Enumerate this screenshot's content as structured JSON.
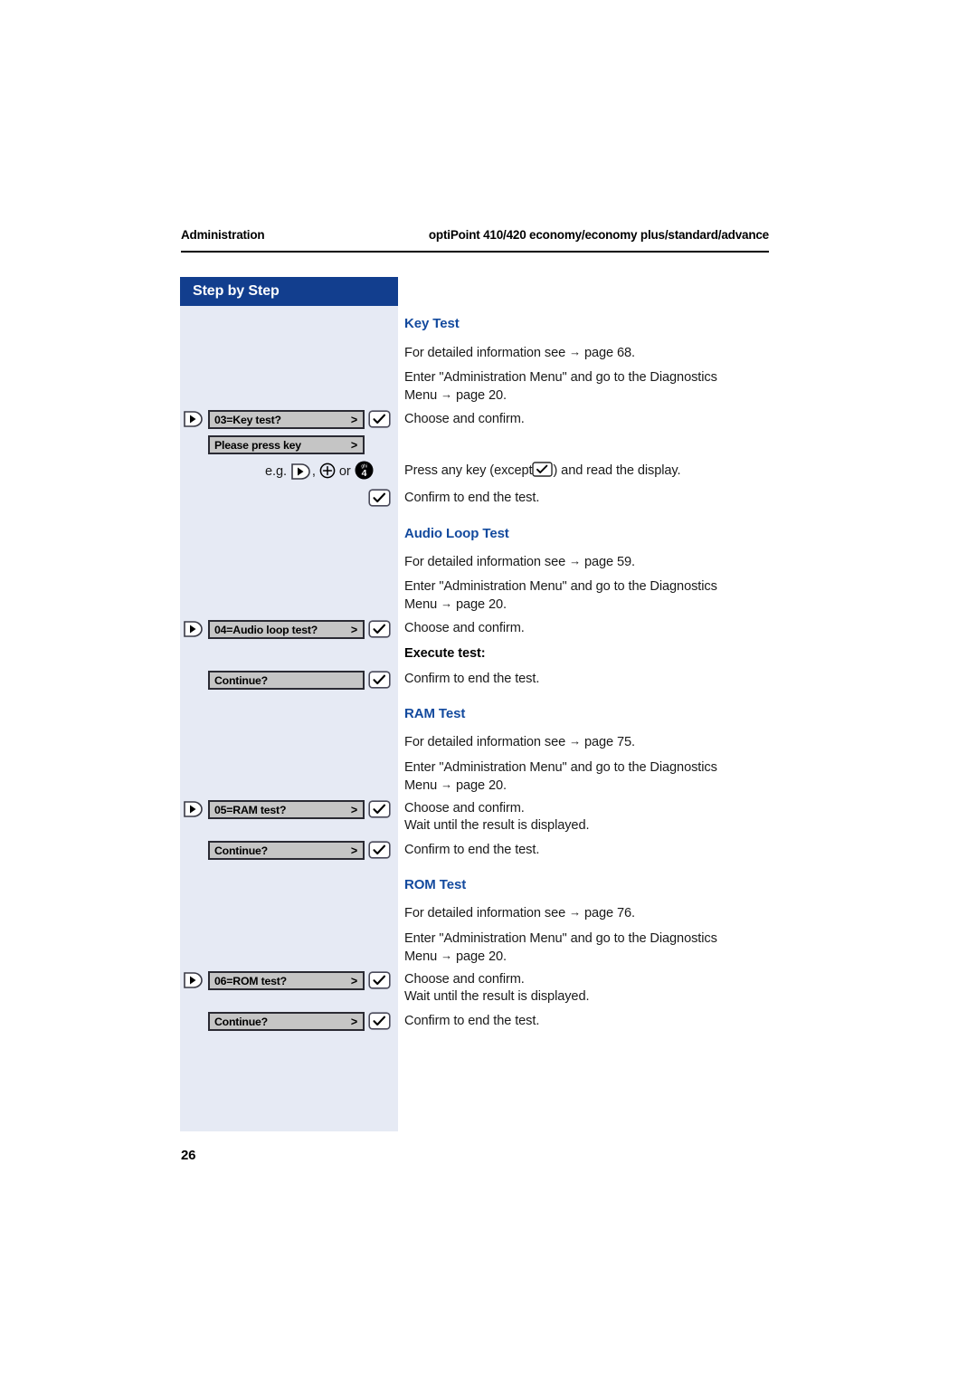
{
  "header": {
    "left": "Administration",
    "right": "optiPoint 410/420 economy/economy plus/standard/advance"
  },
  "sidebar": {
    "title": "Step by Step"
  },
  "folio": "26",
  "icons": {
    "nav": "nav-key-icon",
    "ok": "ok-checkmark-key-icon",
    "plus": "plus-key-icon",
    "key4": "numeric-key-4-icon"
  },
  "sections": [
    {
      "id": "key-test",
      "heading": "Key Test",
      "paragraphs": [
        "For detailed information see → page 68.",
        "Enter \"Administration Menu\" and go to the Diagnostics Menu → page 20.",
        "Choose and confirm.",
        "Press any key (except ✓) and read the display.",
        "Confirm to end the test."
      ],
      "displays": [
        {
          "label": "03=Key test?",
          "caret": ">"
        },
        {
          "label": "Please press key",
          "caret": ">"
        }
      ],
      "eg_prefix": "e.g.",
      "eg_sep": ",",
      "eg_or": "or"
    },
    {
      "id": "audio-loop-test",
      "heading": "Audio Loop Test",
      "paragraphs": [
        "For detailed information see → page 59.",
        "Enter \"Administration Menu\" and go to the Diagnostics Menu → page 20.",
        "Choose and confirm.",
        "Execute test:",
        "Confirm to end the test."
      ],
      "displays": [
        {
          "label": "04=Audio loop test?",
          "caret": ">"
        },
        {
          "label": "Continue?",
          "caret": ""
        }
      ]
    },
    {
      "id": "ram-test",
      "heading": "RAM Test",
      "paragraphs": [
        "For detailed information see → page 75.",
        "Enter \"Administration Menu\" and go to the Diagnostics Menu → page 20.",
        "Choose and confirm.",
        "Wait until the result is displayed.",
        "Confirm to end the test."
      ],
      "displays": [
        {
          "label": "05=RAM test?",
          "caret": ">"
        },
        {
          "label": "Continue?",
          "caret": ">"
        }
      ]
    },
    {
      "id": "rom-test",
      "heading": "ROM Test",
      "paragraphs": [
        "For detailed information see → page 76.",
        "Enter \"Administration Menu\" and go to the Diagnostics Menu → page 20.",
        "Choose and confirm.",
        "Wait until the result is displayed.",
        "Confirm to end the test."
      ],
      "displays": [
        {
          "label": "06=ROM test?",
          "caret": ">"
        },
        {
          "label": "Continue?",
          "caret": ">"
        }
      ]
    }
  ],
  "text": {
    "key_test_p1": "For detailed information see",
    "arrow": "→",
    "page68": "page 68.",
    "page59": "page 59.",
    "page75": "page 75.",
    "page76": "page 76.",
    "enter_menu_a": "Enter \"Administration Menu\" and go to the Diagnostics",
    "enter_menu_b": "Menu",
    "page20": "page 20.",
    "choose_confirm": "Choose and confirm.",
    "press_any_a": "Press any key (except",
    "press_any_b": ") and read the display.",
    "confirm_end": "Confirm to end the test.",
    "execute_test": "Execute test:",
    "wait_result": "Wait until the result is displayed."
  },
  "colors": {
    "brand_blue": "#123e8e",
    "heading_blue": "#134a9e",
    "sidebar_bg": "#e6eaf4",
    "display_bg": "#c5c5c5"
  }
}
